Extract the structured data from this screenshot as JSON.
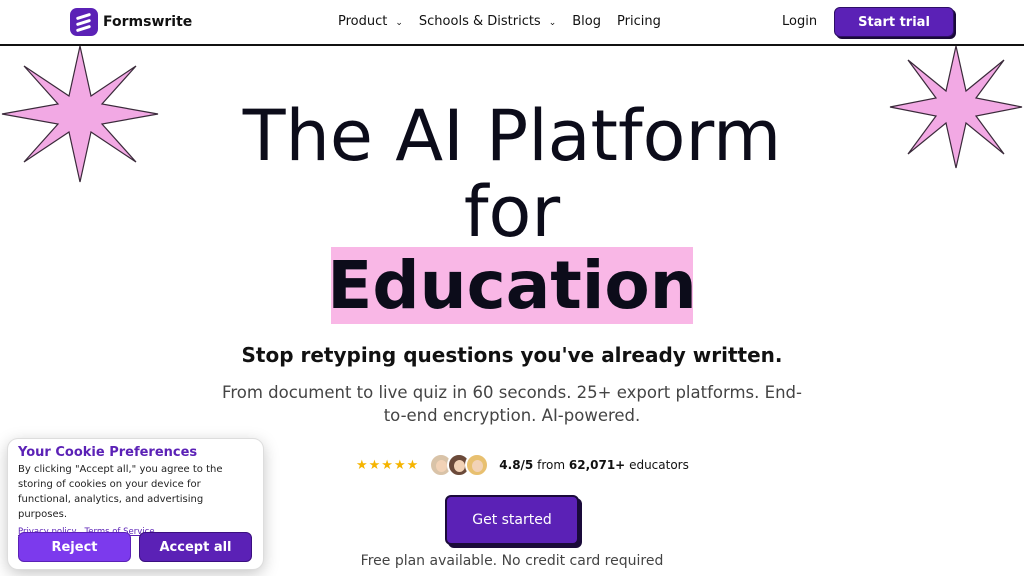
{
  "header": {
    "logo_text": "Formswrite",
    "nav": [
      {
        "label": "Product",
        "has_dropdown": true
      },
      {
        "label": "Schools & Districts",
        "has_dropdown": true
      },
      {
        "label": "Blog",
        "has_dropdown": false
      },
      {
        "label": "Pricing",
        "has_dropdown": false
      }
    ],
    "login_label": "Login",
    "start_trial_label": "Start trial"
  },
  "hero": {
    "line1": "The AI Platform",
    "line2": "for",
    "highlight": "Education",
    "subhead": "Stop retyping questions you've already written.",
    "description": "From document to live quiz in 60 seconds. 25+ export platforms. End-to-end encryption. AI-powered.",
    "stars": "★★★★★",
    "rating_value": "4.8/5",
    "rating_from": "from",
    "rating_count": "62,071+",
    "rating_suffix": "educators",
    "cta_label": "Get started",
    "free_note": "Free plan available. No credit card required"
  },
  "cookie": {
    "title": "Your Cookie Preferences",
    "body": "By clicking \"Accept all,\" you agree to the storing of cookies on your device for functional, analytics, and advertising purposes.",
    "privacy_link": "Privacy policy",
    "terms_link": "Terms of Service",
    "reject_label": "Reject",
    "accept_label": "Accept all"
  },
  "colors": {
    "brand": "#5b21b6",
    "highlight": "#f9b7e6",
    "star_fill": "#f2a9e4",
    "rating_star": "#f5b400"
  },
  "icons": [
    "logo-icon",
    "chevron-down-icon",
    "star-decoration-icon",
    "avatar"
  ]
}
